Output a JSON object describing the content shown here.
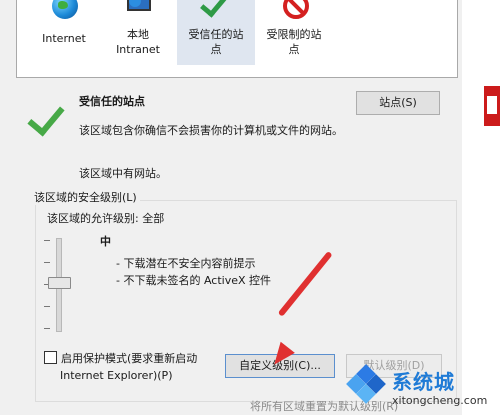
{
  "zones": [
    {
      "label": "Internet",
      "icon": "globe-icon"
    },
    {
      "label": "本地\nIntranet",
      "icon": "local-intranet-icon"
    },
    {
      "label": "受信任的站\n点",
      "icon": "checkmark-icon",
      "selected": true
    },
    {
      "label": "受限制的站\n点",
      "icon": "restricted-icon"
    }
  ],
  "zone_info": {
    "title": "受信任的站点",
    "description": "该区域包含你确信不会损害你的计算机或文件的网站。",
    "has_sites": "该区域中有网站。",
    "sites_button": "站点(S)"
  },
  "security": {
    "group_label": "该区域的安全级别(L)",
    "allowed_levels": "该区域的允许级别: 全部",
    "level_name": "中",
    "level_desc_1": "- 下载潜在不安全内容前提示",
    "level_desc_2": "- 不下载未签名的 ActiveX 控件",
    "slider_level_fraction": 0.5
  },
  "protected_mode": {
    "label_line1": "启用保护模式(要求重新启动",
    "label_line2": "Internet Explorer)(P)",
    "checked": false
  },
  "buttons": {
    "custom_level": "自定义级别(C)...",
    "default_level": "默认级别(D)",
    "reset_all": "将所有区域重置为默认级别(R)"
  },
  "watermark": {
    "brand": "系统城",
    "url": "xitongcheng.com"
  },
  "colors": {
    "accent_arrow": "#e03030",
    "check_green": "#47a947",
    "brand_blue": "#1f7bd6"
  }
}
